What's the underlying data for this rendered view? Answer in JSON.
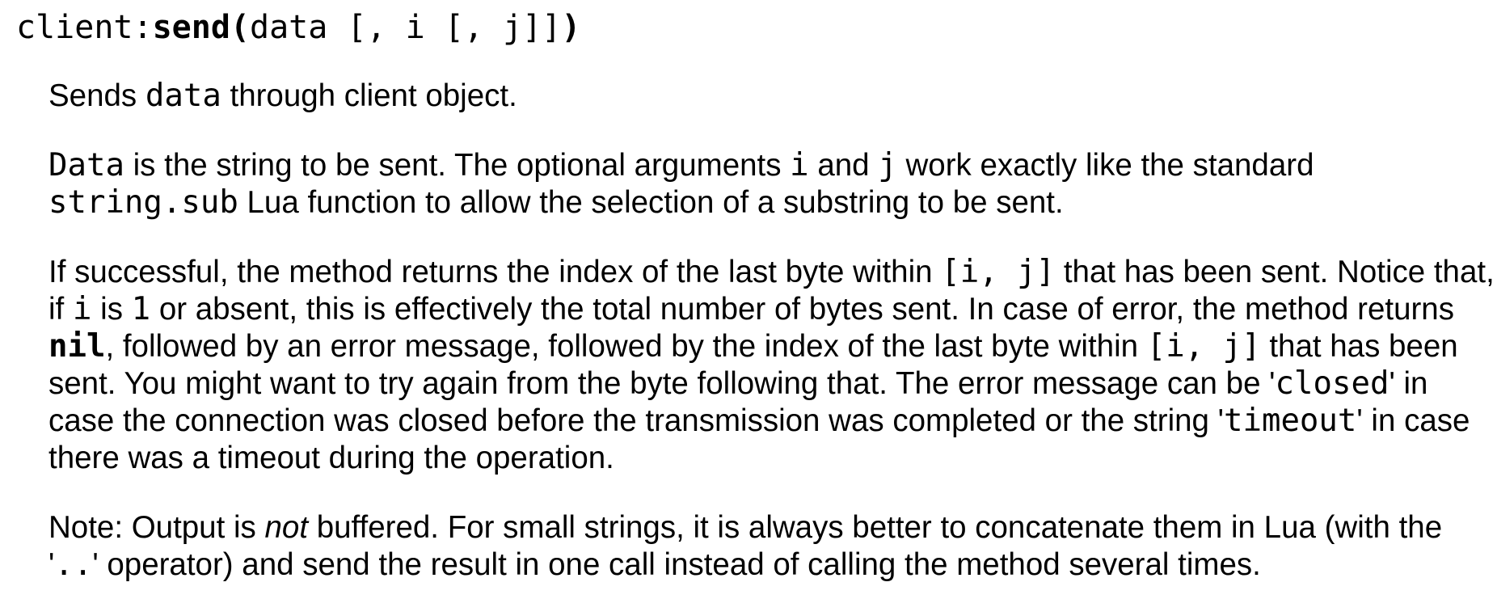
{
  "heading": {
    "prefix": "client:",
    "method": "send(",
    "args": "data [, i [, j]]",
    "close": ")"
  },
  "p1": {
    "t1": "Sends ",
    "c1": "data",
    "t2": " through client object."
  },
  "p2": {
    "c1": "Data",
    "t1": " is the string to be sent. The optional arguments ",
    "c2": "i",
    "t2": " and ",
    "c3": "j",
    "t3": " work exactly like the standard ",
    "c4": "string.sub",
    "t4": " Lua function to allow the selection of a substring to be sent."
  },
  "p3": {
    "t1": "If successful, the method returns the index of the last byte within ",
    "c1": "[i, j]",
    "t2": " that has been sent. Notice that, if ",
    "c2": "i",
    "t3": " is ",
    "c3": "1",
    "t4": " or absent, this is effectively the total number of bytes sent. In case of error, the method returns ",
    "c4": "nil",
    "t5": ", followed by an error message, followed by the index of the last byte within ",
    "c5": "[i, j]",
    "t6": " that has been sent. You might want to try again from the byte following that. The error message can be '",
    "c6": "closed",
    "t7": "' in case the connection was closed before the transmission was completed or the string '",
    "c7": "timeout",
    "t8": "' in case there was a timeout during the operation."
  },
  "p4": {
    "t1": "Note: Output is ",
    "em1": "not",
    "t2": " buffered. For small strings, it is always better to concatenate them in Lua (with the '",
    "c1": "..",
    "t3": "' operator) and send the result in one call instead of calling the method several times."
  }
}
